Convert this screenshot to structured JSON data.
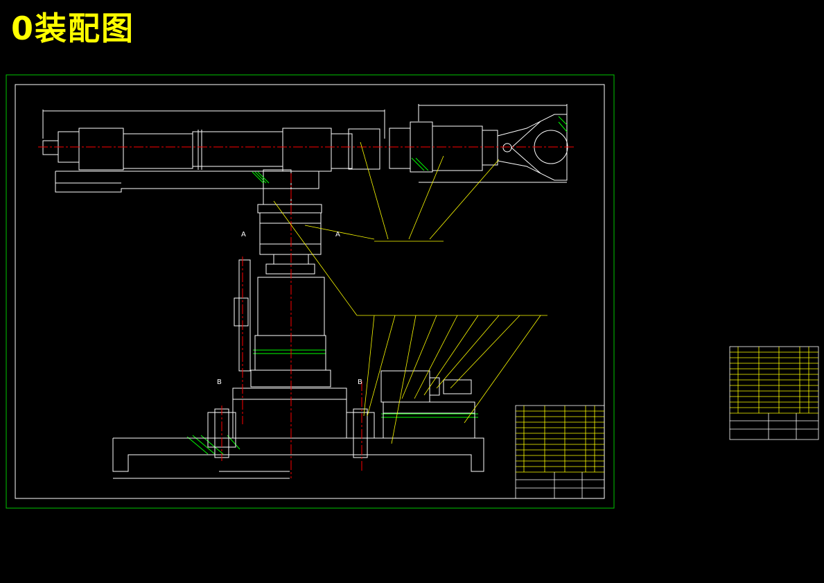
{
  "title": "0装配图",
  "section_labels": {
    "a_left": "A",
    "a_right": "A",
    "b_left": "B",
    "b_right": "B"
  },
  "colors": {
    "background": "#000000",
    "title": "#ffff00",
    "outer_frame": "#00c800",
    "lines": "#ffffff",
    "center_lines": "#ff0000",
    "leaders": "#ffff00",
    "hatch": "#00ff00"
  }
}
